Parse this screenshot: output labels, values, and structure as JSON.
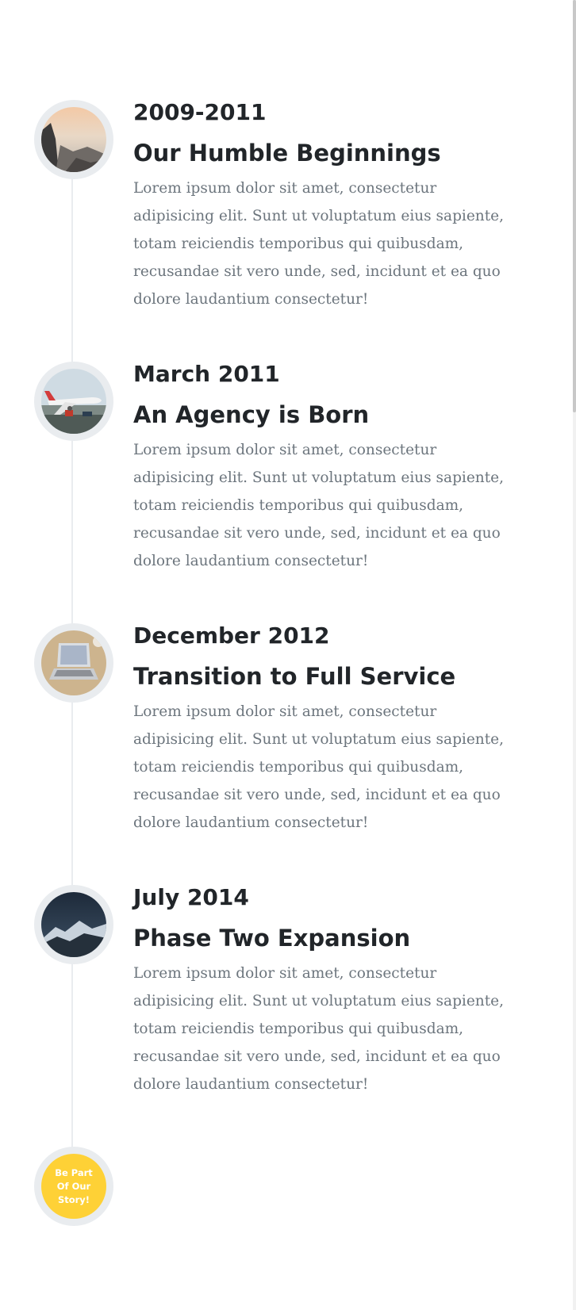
{
  "timeline": {
    "items": [
      {
        "date": "2009-2011",
        "heading": "Our Humble Beginnings",
        "body": "Lorem ipsum dolor sit amet, consectetur adipisicing elit. Sunt ut voluptatum eius sapiente, totam reiciendis temporibus qui quibusdam, recusandae sit vero unde, sed, incidunt et ea quo dolore laudantium consectetur!",
        "image": "mountain-sunset-photo"
      },
      {
        "date": "March 2011",
        "heading": "An Agency is Born",
        "body": "Lorem ipsum dolor sit amet, consectetur adipisicing elit. Sunt ut voluptatum eius sapiente, totam reiciendis temporibus qui quibusdam, recusandae sit vero unde, sed, incidunt et ea quo dolore laudantium consectetur!",
        "image": "airplane-photo"
      },
      {
        "date": "December 2012",
        "heading": "Transition to Full Service",
        "body": "Lorem ipsum dolor sit amet, consectetur adipisicing elit. Sunt ut voluptatum eius sapiente, totam reiciendis temporibus qui quibusdam, recusandae sit vero unde, sed, incidunt et ea quo dolore laudantium consectetur!",
        "image": "laptop-photo"
      },
      {
        "date": "July 2014",
        "heading": "Phase Two Expansion",
        "body": "Lorem ipsum dolor sit amet, consectetur adipisicing elit. Sunt ut voluptatum eius sapiente, totam reiciendis temporibus qui quibusdam, recusandae sit vero unde, sed, incidunt et ea quo dolore laudantium consectetur!",
        "image": "night-mountain-photo"
      }
    ],
    "cta_label": "Be Part Of Our Story!"
  },
  "colors": {
    "heading": "#212529",
    "body": "#6c757d",
    "ring": "#e9ecef",
    "accent": "#fed136"
  }
}
